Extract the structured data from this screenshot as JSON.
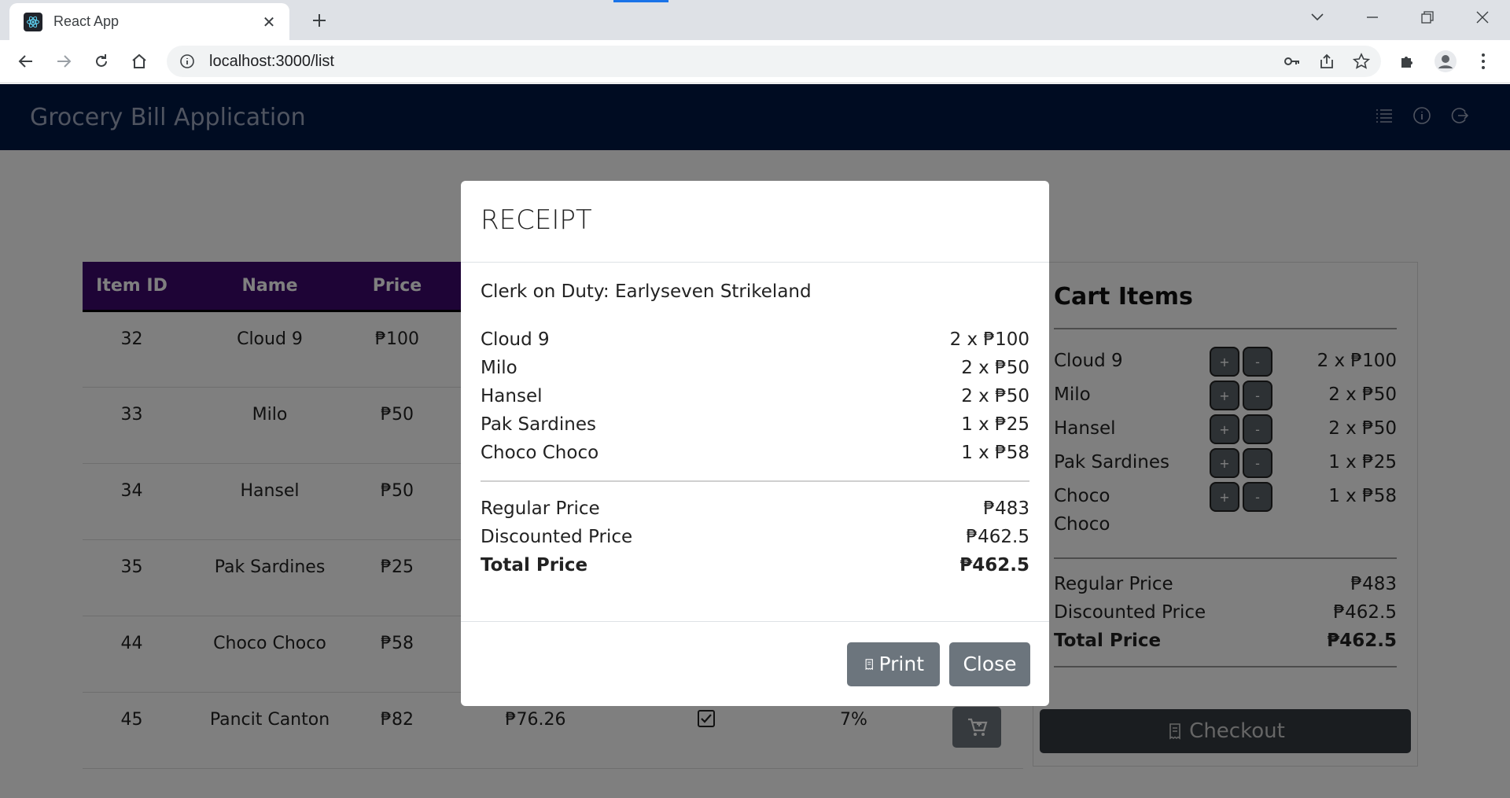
{
  "browser": {
    "tab_title": "React App",
    "url": "localhost:3000/list"
  },
  "app": {
    "brand": "Grocery Bill Application",
    "nav_icons": [
      "list-icon",
      "info-icon",
      "logout-icon"
    ]
  },
  "table": {
    "headers": [
      "Item ID",
      "Name",
      "Price"
    ],
    "rows": [
      {
        "id": "32",
        "name": "Cloud 9",
        "price": "₱100",
        "discounted": "",
        "checked": false,
        "discount": ""
      },
      {
        "id": "33",
        "name": "Milo",
        "price": "₱50",
        "discounted": "",
        "checked": false,
        "discount": ""
      },
      {
        "id": "34",
        "name": "Hansel",
        "price": "₱50",
        "discounted": "",
        "checked": false,
        "discount": ""
      },
      {
        "id": "35",
        "name": "Pak Sardines",
        "price": "₱25",
        "discounted": "",
        "checked": false,
        "discount": ""
      },
      {
        "id": "44",
        "name": "Choco Choco",
        "price": "₱58",
        "discounted": "",
        "checked": false,
        "discount": ""
      },
      {
        "id": "45",
        "name": "Pancit Canton",
        "price": "₱82",
        "discounted": "₱76.26",
        "checked": true,
        "discount": "7%"
      }
    ]
  },
  "cart": {
    "title": "Cart Items",
    "items": [
      {
        "name": "Cloud 9",
        "qty_price": "2 x ₱100"
      },
      {
        "name": "Milo",
        "qty_price": "2 x ₱50"
      },
      {
        "name": "Hansel",
        "qty_price": "2 x ₱50"
      },
      {
        "name": "Pak Sardines",
        "qty_price": "1 x ₱25"
      },
      {
        "name": "Choco Choco",
        "qty_price": "1 x ₱58"
      }
    ],
    "plus_label": "+",
    "minus_label": "-",
    "regular_label": "Regular Price",
    "regular_value": "₱483",
    "discounted_label": "Discounted Price",
    "discounted_value": "₱462.5",
    "total_label": "Total Price",
    "total_value": "₱462.5",
    "checkout_label": "Checkout"
  },
  "receipt": {
    "title": "RECEIPT",
    "clerk": "Clerk on Duty: Earlyseven Strikeland",
    "items": [
      {
        "name": "Cloud 9",
        "qty_price": "2 x ₱100"
      },
      {
        "name": "Milo",
        "qty_price": "2 x ₱50"
      },
      {
        "name": "Hansel",
        "qty_price": "2 x ₱50"
      },
      {
        "name": "Pak Sardines",
        "qty_price": "1 x ₱25"
      },
      {
        "name": "Choco Choco",
        "qty_price": "1 x ₱58"
      }
    ],
    "regular_label": "Regular Price",
    "regular_value": "₱483",
    "discounted_label": "Discounted Price",
    "discounted_value": "₱462.5",
    "total_label": "Total Price",
    "total_value": "₱462.5",
    "print_label": "Print",
    "close_label": "Close"
  }
}
